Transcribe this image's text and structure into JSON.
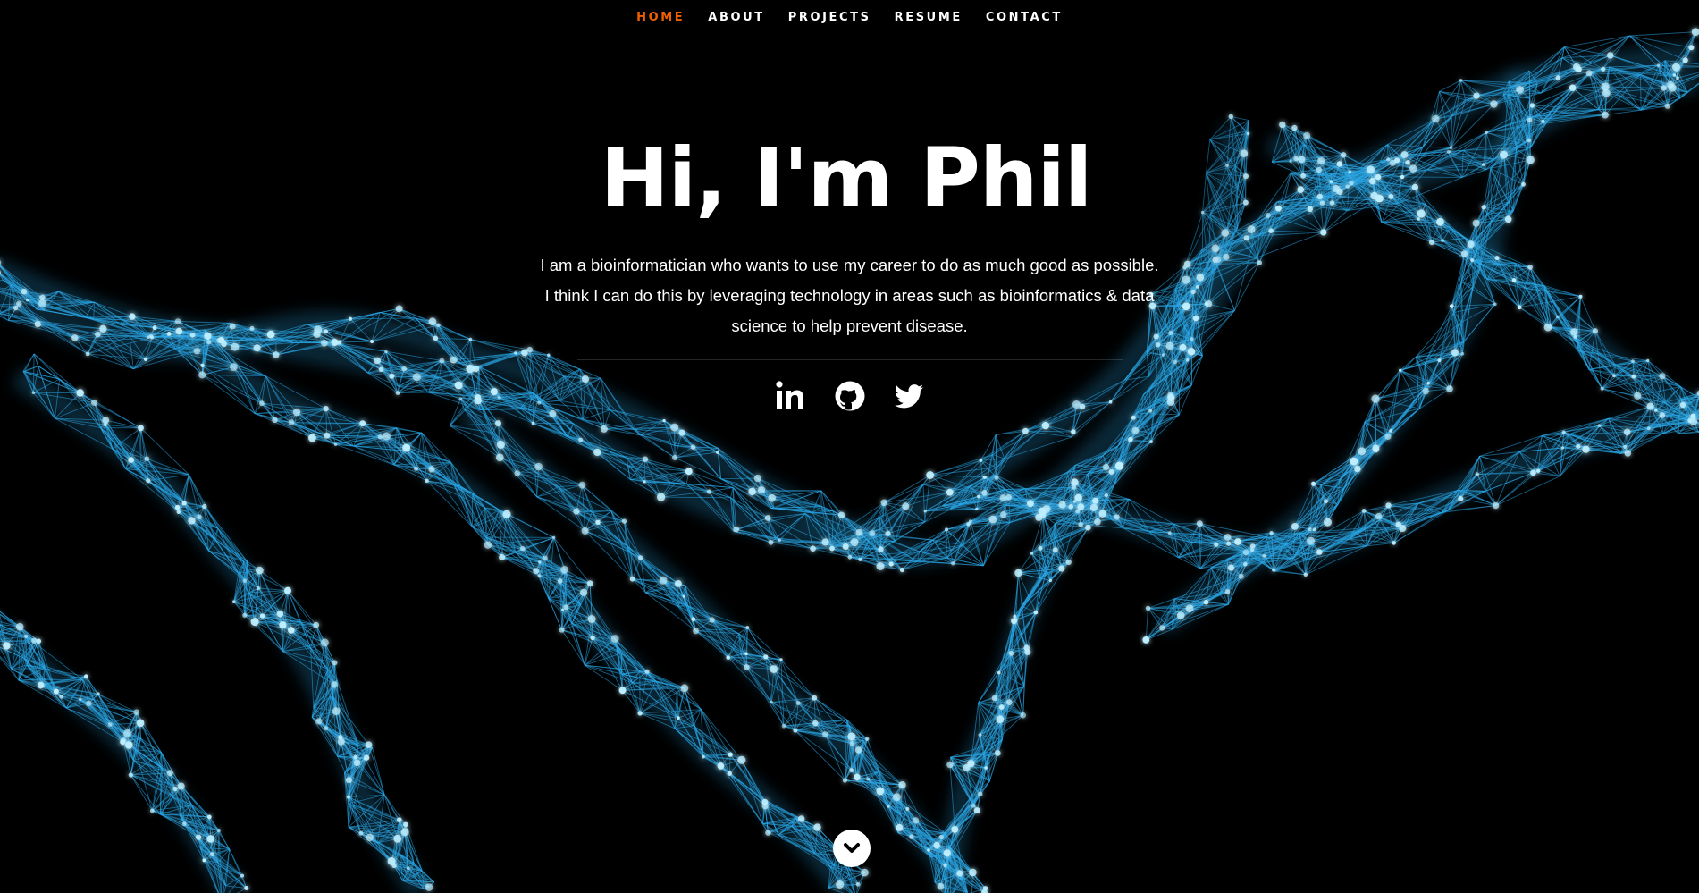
{
  "nav": {
    "items": [
      {
        "label": "HOME",
        "active": true
      },
      {
        "label": "ABOUT",
        "active": false
      },
      {
        "label": "PROJECTS",
        "active": false
      },
      {
        "label": "RESUME",
        "active": false
      },
      {
        "label": "CONTACT",
        "active": false
      }
    ],
    "active_color": "#f06000"
  },
  "hero": {
    "title": "Hi, I'm Phil",
    "description": "I am a bioinformatician who wants to use my career to do as much good as possible. I think I can do this by leveraging technology in areas such as bioinformatics & data science to help prevent disease."
  },
  "social": {
    "icons": [
      "linkedin-icon",
      "github-icon",
      "twitter-icon"
    ]
  },
  "scroll_button": {
    "icon": "chevron-down-icon"
  },
  "background": {
    "description_icon": "dna-network-image",
    "accent_color": "#2aa8e8",
    "glow_color": "#bfefff"
  }
}
